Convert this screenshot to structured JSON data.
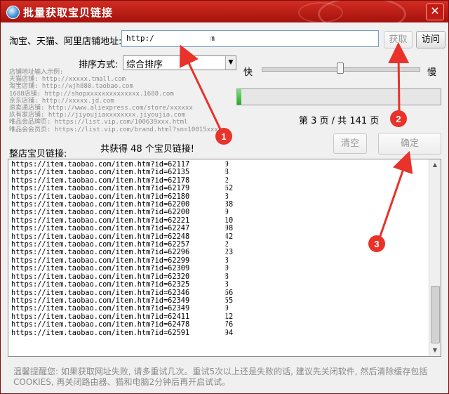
{
  "window": {
    "title": "批量获取宝贝链接",
    "close_glyph": "✕"
  },
  "shop": {
    "label": "淘宝、天猫、阿里店铺地址:",
    "url_value": "http://             .taobao.com",
    "fetch_button": "获取",
    "visit_button": "访问"
  },
  "sort": {
    "label": "排序方式:",
    "selected": "综合排序"
  },
  "speed": {
    "fast_label": "快",
    "slow_label": "慢",
    "level": 0.48
  },
  "progress": {
    "fraction": 0.021
  },
  "examples": [
    "店铺地址输入示例:",
    "天猫店铺: http://xxxxx.tmall.com",
    "淘宝店铺: http://wjh888.taobao.com",
    "1688店铺: http://shopxxxxxxxxxxxxxx.1688.com",
    "京东店铺: http://xxxxx.jd.com",
    "速卖通店铺: http://www.aliexpress.com/store/xxxxxx",
    "玖有家店铺: http://jiyoujiaxxxxxxxx.jiyoujia.com",
    "唯品会品牌页: https://list.vip.com/100639xxx.html",
    "唯品会会员页: https://list.vip.com/brand.html?sn=10015xxx"
  ],
  "page": {
    "text": "第 3 页 / 共 141 页"
  },
  "results": {
    "label": "整店宝贝链接:",
    "summary": "共获得 48 个宝贝链接!",
    "clear_button": "清空",
    "confirm_button": "确定",
    "links": [
      "https://item.taobao.com/item.htm?id=62117     5249",
      "https://item.taobao.com/item.htm?id=62135     2888",
      "https://item.taobao.com/item.htm?id=62178     9512",
      "https://item.taobao.com/item.htm?id=62179     74162",
      "https://item.taobao.com/item.htm?id=62180     9753",
      "https://item.taobao.com/item.htm?id=62200     97138",
      "https://item.taobao.com/item.htm?id=62200     9519",
      "https://item.taobao.com/item.htm?id=62221     41310",
      "https://item.taobao.com/item.htm?id=62247     38598",
      "https://item.taobao.com/item.htm?id=62248     34242",
      "https://item.taobao.com/item.htm?id=62257     2632",
      "https://item.taobao.com/item.htm?id=62296     27023",
      "https://item.taobao.com/item.htm?id=62299     2803",
      "https://item.taobao.com/item.htm?id=62309     6840",
      "https://item.taobao.com/item.htm?id=62320     9358",
      "https://item.taobao.com/item.htm?id=62325     8973",
      "https://item.taobao.com/item.htm?id=62346     10466",
      "https://item.taobao.com/item.htm?id=62349     15955",
      "https://item.taobao.com/item.htm?id=62349     6739",
      "https://item.taobao.com/item.htm?id=62411     59312",
      "https://item.taobao.com/item.htm?id=62478     19276",
      "https://item.taobao.com/item.htm?id=62591     16094"
    ]
  },
  "tip": {
    "text": "温馨提醒您: 如果获取网址失败, 请多重试几次。重试5次以上还是失败的话, 建议先关闭软件, 然后清除缓存包括COOKIES, 再关闭路由器、猫和电脑2分钟后再开启试试。"
  },
  "annotations": {
    "color": "#e8322a",
    "badges": [
      "1",
      "2",
      "3"
    ]
  },
  "icons": {
    "app": "app-globe-icon",
    "dropdown": "chevron-down-icon",
    "scroll_up": "scroll-up-arrow-icon",
    "scroll_down": "scroll-down-arrow-icon"
  }
}
